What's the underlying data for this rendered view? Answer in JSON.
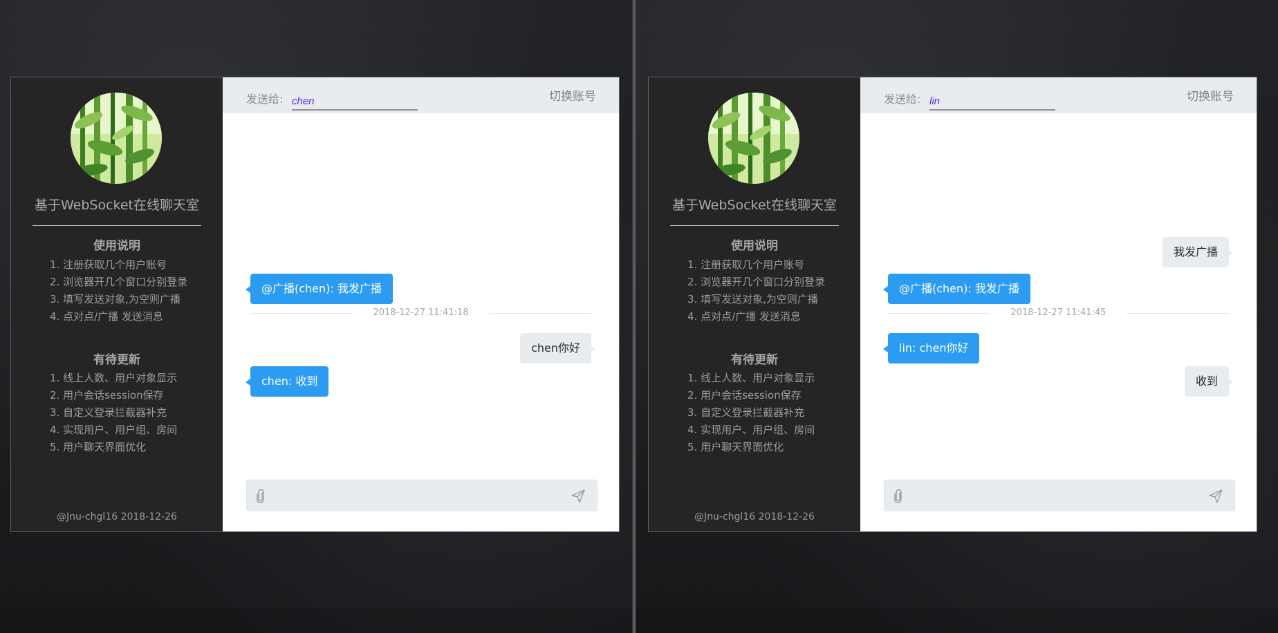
{
  "panels": [
    {
      "sidebar": {
        "title": "基于WebSocket在线聊天室",
        "usage_title": "使用说明",
        "usage_items": [
          "1. 注册获取几个用户账号",
          "2. 浏览器开几个窗口分别登录",
          "3. 填写发送对象,为空则广播",
          "4. 点对点/广播 发送消息"
        ],
        "todo_title": "有待更新",
        "todo_items": [
          "1. 线上人数、用户对象显示",
          "2. 用户会话session保存",
          "3. 自定义登录拦截器补充",
          "4. 实现用户、用户组、房间",
          "5. 用户聊天界面优化"
        ],
        "footer": "@Jnu-chgl16 2018-12-26"
      },
      "topbar": {
        "send_to_label": "发送给:",
        "send_to_value": "chen",
        "switch_account": "切换账号"
      },
      "messages": [
        {
          "side": "left",
          "text": "@广播(chen): 我发广播"
        },
        {
          "type": "time",
          "text": "2018-12-27 11:41:18"
        },
        {
          "side": "right",
          "text": "chen你好"
        },
        {
          "side": "left",
          "text": "chen: 收到"
        }
      ],
      "composer": {
        "value": "",
        "placeholder": ""
      }
    },
    {
      "sidebar": {
        "title": "基于WebSocket在线聊天室",
        "usage_title": "使用说明",
        "usage_items": [
          "1. 注册获取几个用户账号",
          "2. 浏览器开几个窗口分别登录",
          "3. 填写发送对象,为空则广播",
          "4. 点对点/广播 发送消息"
        ],
        "todo_title": "有待更新",
        "todo_items": [
          "1. 线上人数、用户对象显示",
          "2. 用户会话session保存",
          "3. 自定义登录拦截器补充",
          "4. 实现用户、用户组、房间",
          "5. 用户聊天界面优化"
        ],
        "footer": "@Jnu-chgl16 2018-12-26"
      },
      "topbar": {
        "send_to_label": "发送给:",
        "send_to_value": "lin",
        "switch_account": "切换账号"
      },
      "messages": [
        {
          "side": "right",
          "text": "我发广播"
        },
        {
          "side": "left",
          "text": "@广播(chen): 我发广播"
        },
        {
          "type": "time",
          "text": "2018-12-27 11:41:45"
        },
        {
          "side": "left",
          "text": "lin: chen你好"
        },
        {
          "side": "right",
          "text": "收到"
        }
      ],
      "composer": {
        "value": "",
        "placeholder": ""
      }
    }
  ],
  "icons": {
    "attach": "paperclip-icon",
    "send": "paper-plane-icon",
    "avatar": "bamboo-avatar-image"
  },
  "colors": {
    "accent_blue": "#2b9cf2",
    "sidebar_bg": "#252525",
    "bubble_grey": "#e9ecee",
    "send_to_text": "#5b2bd8"
  }
}
